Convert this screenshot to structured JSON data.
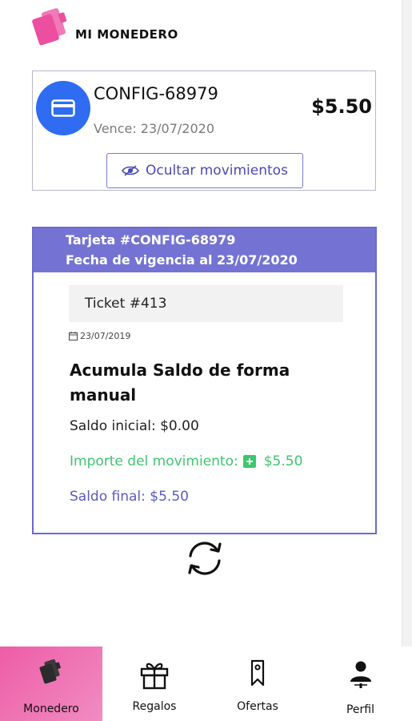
{
  "app": {
    "title": "MI MONEDERO"
  },
  "card": {
    "code": "CONFIG-68979",
    "expiry": "Vence: 23/07/2020",
    "balance": "$5.50",
    "toggle_label": "Ocultar movimientos"
  },
  "detail": {
    "header_line1": "Tarjeta #CONFIG-68979",
    "header_line2": "Fecha de vigencia al 23/07/2020",
    "ticket": "Ticket #413",
    "date": "23/07/2019",
    "title": "Acumula Saldo de forma manual",
    "initial_balance": "Saldo inicial: $0.00",
    "amount_label": "Importe del movimiento:",
    "amount_value": "$5.50",
    "final_balance": "Saldo final: $5.50"
  },
  "nav": {
    "items": [
      {
        "label": "Monedero",
        "icon": "wallet-icon",
        "active": true
      },
      {
        "label": "Regalos",
        "icon": "gift-icon",
        "active": false
      },
      {
        "label": "Ofertas",
        "icon": "tag-icon",
        "active": false
      },
      {
        "label": "Perfil",
        "icon": "user-icon",
        "active": false
      }
    ]
  },
  "colors": {
    "accent_blue": "#2f6cf2",
    "purple": "#7473d4",
    "green": "#3ec66f",
    "pink": "#ee5da8"
  }
}
